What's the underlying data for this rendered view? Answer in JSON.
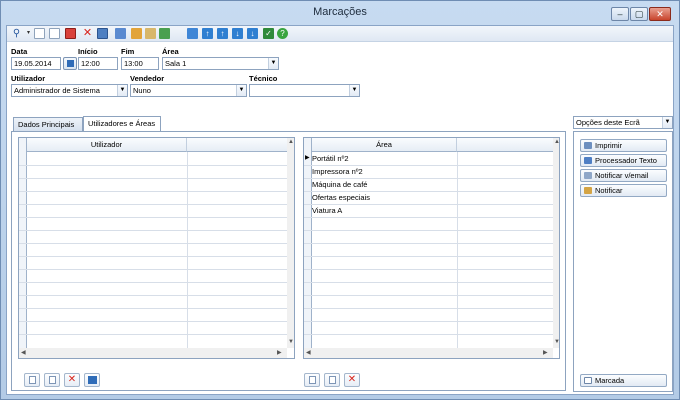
{
  "window": {
    "title": "Marcações"
  },
  "toolbar": {
    "icons": [
      "search-icon",
      "dropdown-arrow-icon",
      "new-document-icon",
      "copy-document-icon",
      "calendar-icon",
      "delete-icon",
      "export-icon",
      "grid-icon",
      "chart-icon",
      "mail-icon",
      "refresh-icon",
      "zoom-icon",
      "upload-icon",
      "up-arrow-icon",
      "down-arrow-icon",
      "download-icon",
      "check-icon",
      "help-icon"
    ]
  },
  "form": {
    "data_label": "Data",
    "data_value": "19.05.2014",
    "inicio_label": "Início",
    "inicio_value": "12:00",
    "fim_label": "Fim",
    "fim_value": "13:00",
    "area_label": "Área",
    "area_value": "Sala 1",
    "utilizador_label": "Utilizador",
    "utilizador_value": "Administrador de Sistema",
    "vendedor_label": "Vendedor",
    "vendedor_value": "Nuno",
    "tecnico_label": "Técnico",
    "tecnico_value": ""
  },
  "tabs": [
    {
      "label": "Dados Principais",
      "active": false
    },
    {
      "label": "Utilizadores e Áreas",
      "active": true
    }
  ],
  "users_grid": {
    "header": "Utilizador",
    "rows": []
  },
  "areas_grid": {
    "header": "Área",
    "rows": [
      "Portátil nº2",
      "Impressora nº2",
      "Máquina de café",
      "Ofertas especiais",
      "Viatura A"
    ]
  },
  "side": {
    "title": "Opções deste Ecrã",
    "buttons": [
      "Imprimir",
      "Processador Texto",
      "Notificar v/email",
      "Notificar"
    ],
    "bottom_button": "Marcada"
  },
  "colors": {
    "accent": "#2f7fd1",
    "delete": "#d8241c",
    "titlebar": "#b9d1ea"
  }
}
